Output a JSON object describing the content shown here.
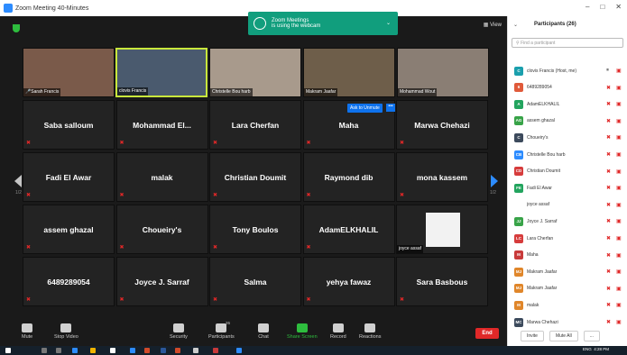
{
  "window": {
    "title": "Zoom Meeting 40-Minutes",
    "controls": [
      "–",
      "□",
      "✕"
    ]
  },
  "view_label": "View",
  "toast": {
    "line1": "Zoom Meetings",
    "line2": "is using the webcam"
  },
  "video_tiles": [
    {
      "label": "Sarah Francis",
      "bg": "#7a5a4a",
      "active": false
    },
    {
      "label": "clovis Francis",
      "bg": "#4a5a6e",
      "active": true
    },
    {
      "label": "Christelle Bou harb",
      "bg": "#a89a8c",
      "active": false
    },
    {
      "label": "Makram Jaafar",
      "bg": "#6e5e4a",
      "active": false
    },
    {
      "label": "Mohammad Wout",
      "bg": "#8a7e74",
      "active": false
    }
  ],
  "name_tiles": [
    "Saba salloum",
    "Mohammad El...",
    "Lara Cherfan",
    "Maha",
    "Marwa Chehazi",
    "Fadi El Awar",
    "malak",
    "Christian Doumit",
    "Raymond dib",
    "mona kassem",
    "assem ghazal",
    "Choueiry's",
    "Tony Boulos",
    "AdamELKHALIL",
    "",
    "6489289054",
    "Joyce J. Sarraf",
    "Salma",
    "yehya fawaz",
    "Sara Basbous"
  ],
  "joyce_tile_label": "joyce assaf",
  "unmute_label": "Ask to Unmute",
  "more_label": "•••",
  "page_indicator": "1/2",
  "page_indicator_right": "1/2",
  "toolbar": [
    {
      "label": "Mute",
      "icon": "microphone-icon"
    },
    {
      "label": "Stop Video",
      "icon": "video-camera-icon"
    },
    {
      "label": "Security",
      "icon": "shield-icon"
    },
    {
      "label": "Participants",
      "icon": "participants-icon",
      "count": "26"
    },
    {
      "label": "Chat",
      "icon": "chat-icon"
    },
    {
      "label": "Share Screen",
      "icon": "share-screen-icon"
    },
    {
      "label": "Record",
      "icon": "record-icon"
    },
    {
      "label": "Reactions",
      "icon": "reactions-icon"
    }
  ],
  "end_label": "End",
  "participants_panel": {
    "title": "Participants (26)",
    "search_placeholder": "Find a participant",
    "participants": [
      {
        "initials": "C",
        "name": "clovis Francis (Host, me)",
        "color": "#1a9fad",
        "mic": "on"
      },
      {
        "initials": "6",
        "name": "6489289054",
        "color": "#e05a3a",
        "mic": "off"
      },
      {
        "initials": "A",
        "name": "AdamELKHALIL",
        "color": "#23a45e",
        "mic": "off"
      },
      {
        "initials": "AG",
        "name": "assem ghazal",
        "color": "#38a348",
        "mic": "off"
      },
      {
        "initials": "C",
        "name": "Choueiry's",
        "color": "#3c4a5c",
        "mic": "off"
      },
      {
        "initials": "CB",
        "name": "Christelle Bou harb",
        "color": "#2d8cff",
        "mic": "off"
      },
      {
        "initials": "CD",
        "name": "Christian Doumit",
        "color": "#d63c3c",
        "mic": "off"
      },
      {
        "initials": "FE",
        "name": "Fadi El Awar",
        "color": "#23a45e",
        "mic": "off"
      },
      {
        "initials": "",
        "name": "joyce assaf",
        "color": "#ffffff",
        "mic": "off"
      },
      {
        "initials": "JJ",
        "name": "Joyce J. Sarraf",
        "color": "#38a348",
        "mic": "off"
      },
      {
        "initials": "LC",
        "name": "Lara Cherfan",
        "color": "#d63c3c",
        "mic": "off"
      },
      {
        "initials": "M",
        "name": "Maha",
        "color": "#c83a3a",
        "mic": "off"
      },
      {
        "initials": "MJ",
        "name": "Makram Jaafar",
        "color": "#e0862a",
        "mic": "off"
      },
      {
        "initials": "MJ",
        "name": "Makram Jaafar",
        "color": "#e0862a",
        "mic": "off"
      },
      {
        "initials": "M",
        "name": "malak",
        "color": "#e0862a",
        "mic": "off"
      },
      {
        "initials": "MC",
        "name": "Marwa Chehazi",
        "color": "#3c4a5c",
        "mic": "off"
      }
    ],
    "invite_label": "Invite",
    "mute_all_label": "Mute All",
    "more_label": "..."
  },
  "taskbar": {
    "time": "4:28 PM",
    "lang": "ENG"
  }
}
